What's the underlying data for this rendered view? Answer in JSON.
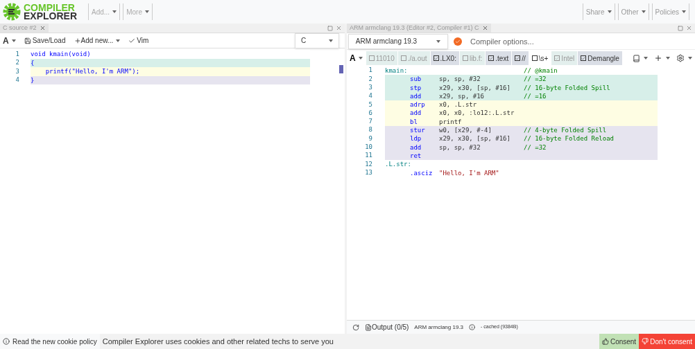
{
  "header": {
    "logo_top": "COMPILER",
    "logo_bottom": "EXPLORER",
    "menus_left": [
      "Add...",
      "More"
    ],
    "menus_right": [
      "Share",
      "Other",
      "Policies"
    ]
  },
  "source_pane": {
    "tab": "C source #2",
    "toolbar": {
      "font_button": "A",
      "save": "Save/Load",
      "add_new": "Add new...",
      "vim": "Vim"
    },
    "language": "C",
    "lines": [
      {
        "number": "1",
        "text": "void kmain(void)",
        "color": "#ffffff"
      },
      {
        "number": "2",
        "text": "{",
        "color": "#d7efe9"
      },
      {
        "number": "3",
        "text": "    printf(\"Hello, I'm ARM\");",
        "color": "#fefde3"
      },
      {
        "number": "4",
        "text": "}",
        "color": "#e6e4ef"
      }
    ]
  },
  "compiler_pane": {
    "tab": "ARM armclang 19.3 (Editor #2, Compiler #1) C",
    "compiler": "ARM armclang 19.3",
    "options_placeholder": "Compiler options...",
    "font_button": "A",
    "filters": [
      {
        "label": "11010",
        "checked": false,
        "disabled": true
      },
      {
        "label": "./a.out",
        "checked": false,
        "disabled": true
      },
      {
        "label": ".LX0:",
        "checked": true,
        "disabled": false
      },
      {
        "label": "lib.f:",
        "checked": false,
        "disabled": true
      },
      {
        "label": ".text",
        "checked": true,
        "disabled": false
      },
      {
        "label": "//",
        "checked": true,
        "disabled": false
      },
      {
        "label": "\\s+",
        "checked": false,
        "disabled": false
      },
      {
        "label": "Intel",
        "checked": true,
        "disabled": true
      },
      {
        "label": "Demangle",
        "checked": true,
        "disabled": false
      }
    ],
    "lines": [
      {
        "number": "1",
        "label": "kmain:",
        "comment": "// @kmain",
        "color": "#ffffff"
      },
      {
        "number": "2",
        "op": "sub",
        "args": "sp, sp, #32",
        "comment": "// =32",
        "color": "#d7efe9"
      },
      {
        "number": "3",
        "op": "stp",
        "args": "x29, x30, [sp, #16]",
        "comment": "// 16-byte Folded Spill",
        "color": "#d7efe9"
      },
      {
        "number": "4",
        "op": "add",
        "args": "x29, sp, #16",
        "comment": "// =16",
        "color": "#d7efe9"
      },
      {
        "number": "5",
        "op": "adrp",
        "args": "x0, .L.str",
        "color": "#fefde3"
      },
      {
        "number": "6",
        "op": "add",
        "args": "x0, x0, :lo12:.L.str",
        "color": "#fefde3"
      },
      {
        "number": "7",
        "op": "bl",
        "args": "printf",
        "color": "#fefde3"
      },
      {
        "number": "8",
        "op": "stur",
        "args": "w0, [x29, #-4]",
        "comment": "// 4-byte Folded Spill",
        "color": "#e6e4ef"
      },
      {
        "number": "9",
        "op": "ldp",
        "args": "x29, x30, [sp, #16]",
        "comment": "// 16-byte Folded Reload",
        "color": "#e6e4ef"
      },
      {
        "number": "10",
        "op": "add",
        "args": "sp, sp, #32",
        "comment": "// =32",
        "color": "#e6e4ef"
      },
      {
        "number": "11",
        "op": "ret",
        "color": "#e6e4ef"
      },
      {
        "number": "12",
        "label": ".L.str:",
        "color": "#ffffff"
      },
      {
        "number": "13",
        "op": ".asciz",
        "args": "\"Hello, I'm ARM\"",
        "color": "#ffffff"
      }
    ],
    "output": {
      "label": "Output (0/5)",
      "compiler": "ARM armclang 19.3",
      "cached": "- cached (9384B)"
    }
  },
  "cookie_bar": {
    "policy_link": "Read the new cookie policy",
    "message": "Compiler Explorer uses cookies and other related techs to serve you",
    "consent": "Consent",
    "dont_consent": "Don't consent"
  }
}
